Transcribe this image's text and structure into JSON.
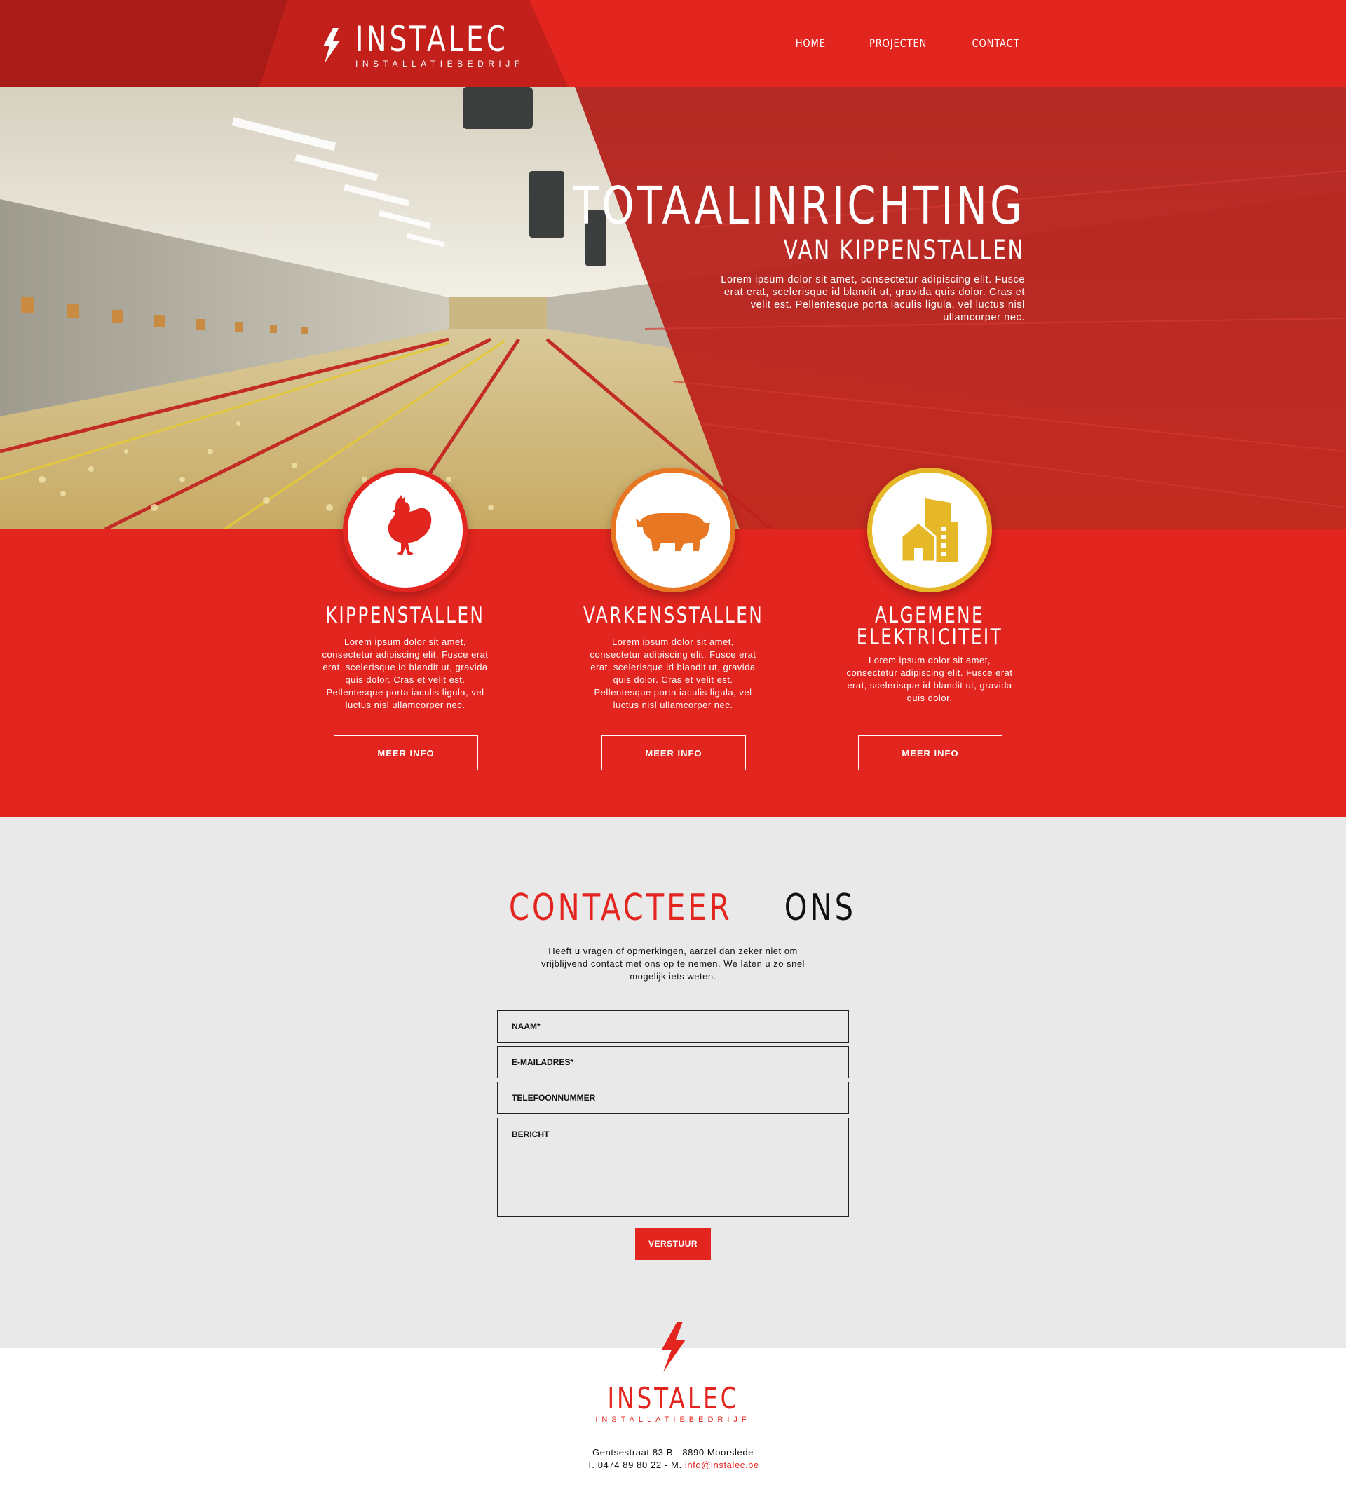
{
  "brand": {
    "name": "INSTALEC",
    "tagline": "INSTALLATIEBEDRIJF"
  },
  "nav": {
    "items": [
      "HOME",
      "PROJECTEN",
      "CONTACT"
    ]
  },
  "hero": {
    "title": "TOTAALINRICHTING",
    "subtitle": "VAN KIPPENSTALLEN",
    "text": "Lorem ipsum dolor sit amet, consectetur adipiscing elit. Fusce erat erat, scelerisque id blandit ut, gravida quis dolor. Cras et velit est. Pellentesque porta iaculis ligula, vel luctus nisl ullamcorper nec."
  },
  "services": [
    {
      "icon": "chicken-icon",
      "title": "KIPPENSTALLEN",
      "text": "Lorem ipsum dolor sit amet, consectetur adipiscing elit. Fusce erat erat, scelerisque id blandit ut, gravida quis dolor. Cras et velit est. Pellentesque porta iaculis ligula, vel luctus nisl ullamcorper nec.",
      "button": "MEER INFO",
      "color": "#e3251f"
    },
    {
      "icon": "pig-icon",
      "title": "VARKENSSTALLEN",
      "text": "Lorem ipsum dolor sit amet, consectetur adipiscing elit. Fusce erat erat, scelerisque id blandit ut, gravida quis dolor. Cras et velit est. Pellentesque porta iaculis ligula, vel luctus nisl ullamcorper nec.",
      "button": "MEER INFO",
      "color": "#e87724"
    },
    {
      "icon": "building-icon",
      "title": "ALGEMENE ELEKTRICITEIT",
      "text": "Lorem ipsum dolor sit amet, consectetur adipiscing elit. Fusce erat erat, scelerisque id blandit ut, gravida quis dolor.",
      "button": "MEER INFO",
      "color": "#e6b726"
    }
  ],
  "contact": {
    "title_red": "CONTACTEER",
    "title_black": "ONS",
    "intro": "Heeft u vragen of opmerkingen, aarzel dan zeker niet om vrijblijvend contact met ons op te nemen.  We laten u zo snel mogelijk iets weten.",
    "fields": {
      "name_placeholder": "NAAM*",
      "email_placeholder": "E-MAILADRES*",
      "phone_placeholder": "TELEFOONNUMMER",
      "message_placeholder": "BERICHT"
    },
    "submit": "VERSTUUR"
  },
  "footer": {
    "name": "INSTALEC",
    "tagline": "INSTALLATIEBEDRIJF",
    "address": "Gentsestraat 83 B - 8890 Moorslede",
    "phone_line": "T. 0474 89 80 22 - M.",
    "email": "info@instalec.be"
  },
  "colors": {
    "brand_red": "#e3251f",
    "dark_red": "#a91b17",
    "orange": "#e87724",
    "yellow": "#e6b726",
    "light_gray": "#e9e9e9"
  }
}
